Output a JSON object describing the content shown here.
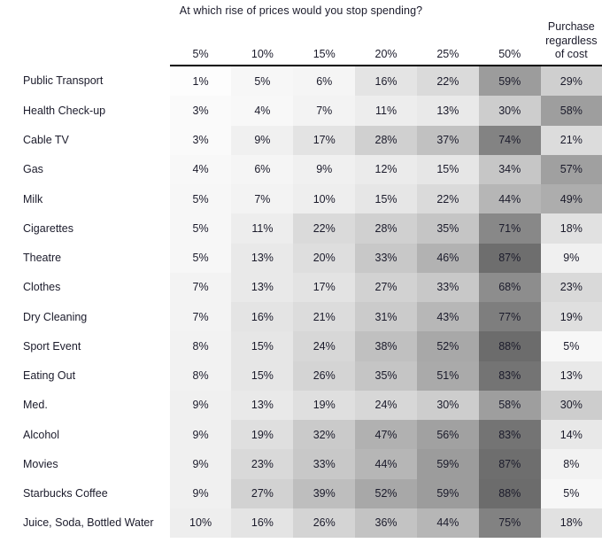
{
  "title": "At which rise of prices would you stop spending?",
  "colors": {
    "text": "#1b1b2b",
    "background": "#ffffff",
    "header_rule": "#000000",
    "scale_low": "#ffffff",
    "scale_high": "#646464"
  },
  "scale": {
    "min_value": 0,
    "max_value": 100,
    "min_color_level": 255,
    "max_color_level": 88
  },
  "chart_data": {
    "type": "heatmap",
    "title": "At which rise of prices would you stop spending?",
    "xlabel": "",
    "ylabel": "",
    "value_suffix": "%",
    "row_header": "",
    "categories": [
      "5%",
      "10%",
      "15%",
      "20%",
      "25%",
      "50%",
      "Purchase regardless of cost"
    ],
    "column_headers": [
      {
        "lines": [
          "5%"
        ]
      },
      {
        "lines": [
          "10%"
        ]
      },
      {
        "lines": [
          "15%"
        ]
      },
      {
        "lines": [
          "20%"
        ]
      },
      {
        "lines": [
          "25%"
        ]
      },
      {
        "lines": [
          "50%"
        ]
      },
      {
        "lines": [
          "Purchase",
          "regardless",
          "of cost"
        ]
      }
    ],
    "rows": [
      {
        "label": "Public Transport",
        "values": [
          1,
          5,
          6,
          16,
          22,
          59,
          29
        ]
      },
      {
        "label": "Health Check-up",
        "values": [
          3,
          4,
          7,
          11,
          13,
          30,
          58
        ]
      },
      {
        "label": "Cable TV",
        "values": [
          3,
          9,
          17,
          28,
          37,
          74,
          21
        ]
      },
      {
        "label": "Gas",
        "values": [
          4,
          6,
          9,
          12,
          15,
          34,
          57
        ]
      },
      {
        "label": "Milk",
        "values": [
          5,
          7,
          10,
          15,
          22,
          44,
          49
        ]
      },
      {
        "label": "Cigarettes",
        "values": [
          5,
          11,
          22,
          28,
          35,
          71,
          18
        ]
      },
      {
        "label": "Theatre",
        "values": [
          5,
          13,
          20,
          33,
          46,
          87,
          9
        ]
      },
      {
        "label": "Clothes",
        "values": [
          7,
          13,
          17,
          27,
          33,
          68,
          23
        ]
      },
      {
        "label": "Dry Cleaning",
        "values": [
          7,
          16,
          21,
          31,
          43,
          77,
          19
        ]
      },
      {
        "label": "Sport Event",
        "values": [
          8,
          15,
          24,
          38,
          52,
          88,
          5
        ]
      },
      {
        "label": "Eating Out",
        "values": [
          8,
          15,
          26,
          35,
          51,
          83,
          13
        ]
      },
      {
        "label": "Med.",
        "values": [
          9,
          13,
          19,
          24,
          30,
          58,
          30
        ]
      },
      {
        "label": "Alcohol",
        "values": [
          9,
          19,
          32,
          47,
          56,
          83,
          14
        ]
      },
      {
        "label": "Movies",
        "values": [
          9,
          23,
          33,
          44,
          59,
          87,
          8
        ]
      },
      {
        "label": "Starbucks Coffee",
        "values": [
          9,
          27,
          39,
          52,
          59,
          88,
          5
        ]
      },
      {
        "label": "Juice, Soda, Bottled Water",
        "values": [
          10,
          16,
          26,
          36,
          44,
          75,
          18
        ]
      }
    ]
  }
}
